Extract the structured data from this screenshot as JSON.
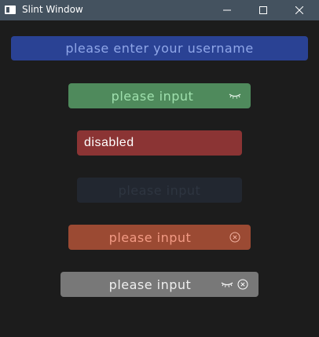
{
  "window": {
    "title": "Slint Window"
  },
  "fields": {
    "username": {
      "text": "please enter your username"
    },
    "green": {
      "text": "please input"
    },
    "disabled": {
      "text": "disabled"
    },
    "dark": {
      "text": "please input"
    },
    "orange": {
      "text": "please input"
    },
    "gray": {
      "text": "please input"
    }
  },
  "icons": {
    "password_toggle": "eye-closed-icon",
    "clear": "clear-circle-icon"
  },
  "colors": {
    "titlebar": "#44525f",
    "background": "#1c1c1c",
    "username_field": "#2a4294",
    "green_field": "#4f8a5c",
    "disabled_field": "#8b3434",
    "dark_field": "#222730",
    "orange_field": "#9b4a33",
    "gray_field": "#787878"
  }
}
